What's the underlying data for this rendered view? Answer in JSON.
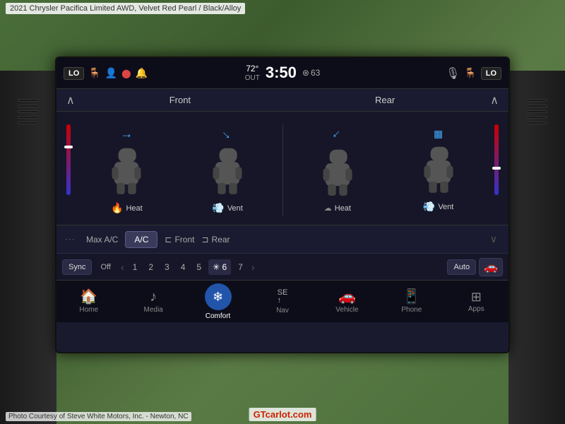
{
  "meta": {
    "title": "2021 Chrysler Pacifica Limited AWD,  Velvet Red Pearl / Black/Alloy"
  },
  "watermark": {
    "top": "2021 Chrysler Pacifica Limited AWD,  Velvet Red Pearl / Black/Alloy",
    "bottom": "Photo Courtesy of Steve White Motors, Inc. - Newton, NC",
    "logo": "GTcarlot.com"
  },
  "status_bar": {
    "lo_left": "LO",
    "lo_right": "LO",
    "temp": "72°",
    "temp_label": "OUT",
    "time": "3:50",
    "fan_speed": "63",
    "icons": {
      "seat_heat": "🪑",
      "bell": "🔔",
      "circle": "⬤",
      "mic": "🎙"
    }
  },
  "climate": {
    "front_label": "Front",
    "rear_label": "Rear",
    "front_heat_label": "Heat",
    "front_vent_label": "Vent",
    "rear_heat_label": "Heat",
    "rear_vent_label": "Vent",
    "max_ac_label": "Max A/C",
    "ac_label": "A/C",
    "front_air_label": "Front",
    "rear_air_label": "Rear"
  },
  "fan_controls": {
    "sync_label": "Sync",
    "off_label": "Off",
    "speeds": [
      "1",
      "2",
      "3",
      "4",
      "5",
      "6",
      "7"
    ],
    "active_speed": "6",
    "auto_label": "Auto"
  },
  "nav": {
    "items": [
      {
        "id": "home",
        "label": "Home",
        "icon": "🏠"
      },
      {
        "id": "media",
        "label": "Media",
        "icon": "♪"
      },
      {
        "id": "comfort",
        "label": "Comfort",
        "icon": "❄"
      },
      {
        "id": "nav",
        "label": "Nav",
        "icon": "SE"
      },
      {
        "id": "vehicle",
        "label": "Vehicle",
        "icon": "🚗"
      },
      {
        "id": "phone",
        "label": "Phone",
        "icon": "📱"
      },
      {
        "id": "apps",
        "label": "Apps",
        "icon": "⊞"
      }
    ]
  }
}
